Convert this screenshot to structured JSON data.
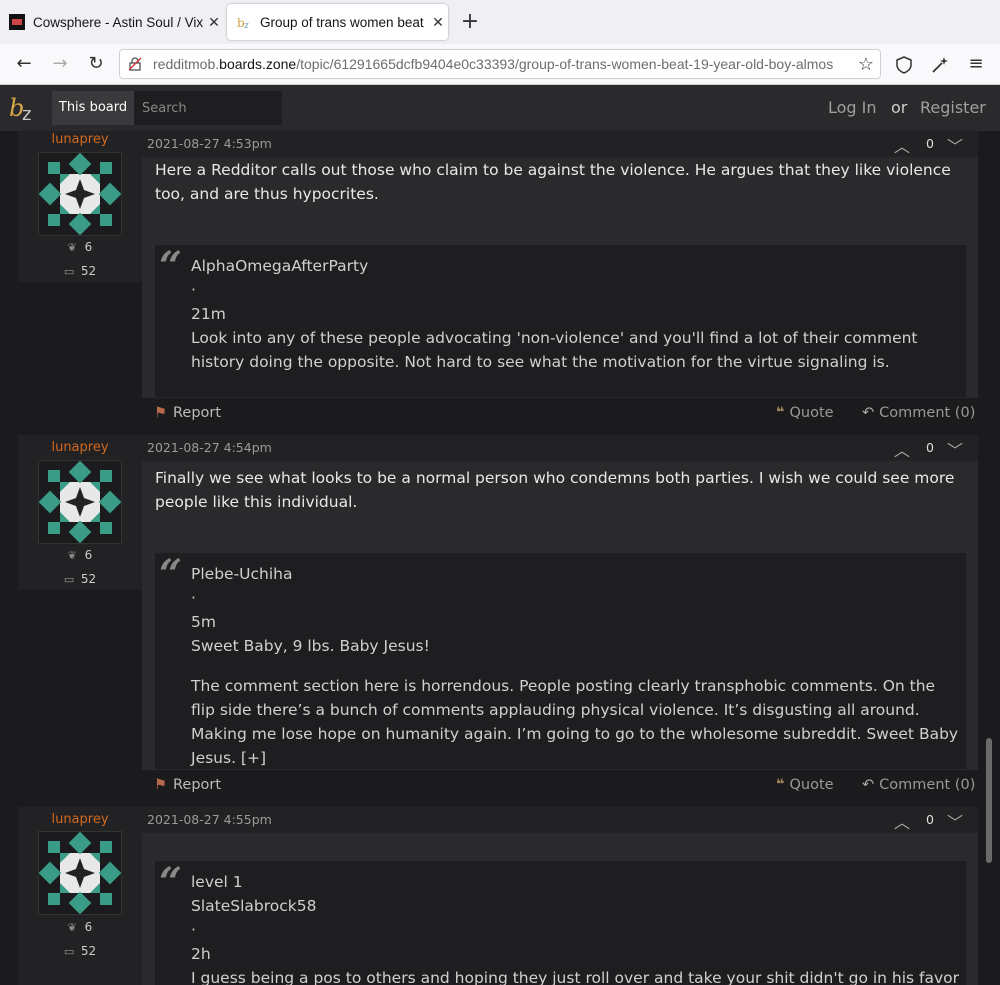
{
  "browser": {
    "tabs": [
      {
        "title": "Cowsphere - Astin Soul / Vix"
      },
      {
        "title": "Group of trans women beat 1"
      }
    ],
    "url": {
      "prefix": "redditmob.",
      "host": "boards.zone",
      "path": "/topic/61291665dcfb9404e0c33393/group-of-trans-women-beat-19-year-old-boy-almos"
    }
  },
  "header": {
    "this_board": "This board",
    "search_placeholder": "Search",
    "login": "Log In",
    "or": "or",
    "register": "Register"
  },
  "posts": [
    {
      "username": "lunaprey",
      "seeds": "6",
      "comments": "52",
      "date": "2021-08-27 4:53pm",
      "votes": "0",
      "text": "Here a Redditor calls out those who claim to be against the violence. He argues that they like violence too, and are thus hypocrites.",
      "quote": [
        "AlphaOmegaAfterParty",
        "·",
        "21m",
        "Look into any of these people advocating 'non-violence' and you'll find a lot of their comment history doing the opposite. Not hard to see what the motivation for the virtue signaling is."
      ],
      "report": "Report",
      "quote_btn": "Quote",
      "comment_btn": "Comment (0)"
    },
    {
      "username": "lunaprey",
      "seeds": "6",
      "comments": "52",
      "date": "2021-08-27 4:54pm",
      "votes": "0",
      "text": "Finally we see what looks to be a normal person who condemns both parties. I wish we could see more people like this individual.",
      "quote": [
        "Plebe-Uchiha",
        "·",
        "5m",
        "Sweet Baby, 9 lbs. Baby Jesus!",
        "The comment section here is horrendous. People posting clearly transphobic comments. On the flip side there’s a bunch of comments applauding physical violence. It’s disgusting all around. Making me lose hope on humanity again. I’m going to go to the wholesome subreddit. Sweet Baby Jesus. [+]"
      ],
      "report": "Report",
      "quote_btn": "Quote",
      "comment_btn": "Comment (0)"
    },
    {
      "username": "lunaprey",
      "seeds": "6",
      "comments": "52",
      "date": "2021-08-27 4:55pm",
      "votes": "0",
      "quote": [
        "level 1",
        "SlateSlabrock58",
        "·",
        "2h",
        "I guess being a pos to others and hoping they just roll over and take your shit didn't go in his favor"
      ]
    }
  ]
}
